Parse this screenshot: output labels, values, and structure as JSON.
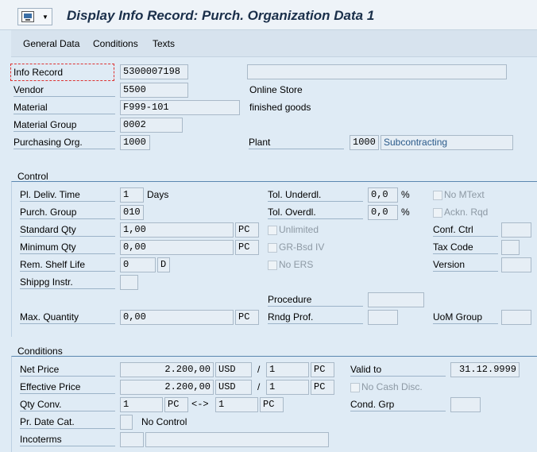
{
  "title": "Display Info Record: Purch. Organization Data 1",
  "toolbar": {
    "tabs": [
      "General Data",
      "Conditions",
      "Texts"
    ]
  },
  "header": {
    "info_record_label": "Info Record",
    "info_record": "5300007198",
    "vendor_label": "Vendor",
    "vendor": "5500",
    "vendor_name": "Online Store",
    "material_label": "Material",
    "material": "F999-101",
    "material_desc": "finished goods",
    "material_group_label": "Material Group",
    "material_group": "0002",
    "purch_org_label": "Purchasing Org.",
    "purch_org": "1000",
    "plant_label": "Plant",
    "plant": "1000",
    "plant_text": "Subcontracting"
  },
  "control": {
    "title": "Control",
    "pl_deliv_label": "Pl. Deliv. Time",
    "pl_deliv": "1",
    "days": "Days",
    "purch_group_label": "Purch. Group",
    "purch_group": "010",
    "std_qty_label": "Standard Qty",
    "std_qty": "1,00",
    "std_uom": "PC",
    "min_qty_label": "Minimum Qty",
    "min_qty": "0,00",
    "min_uom": "PC",
    "shelf_label": "Rem. Shelf Life",
    "shelf": "0",
    "shelf_unit": "D",
    "shippg_label": "Shippg Instr.",
    "max_qty_label": "Max. Quantity",
    "max_qty": "0,00",
    "max_uom": "PC",
    "tol_under_label": "Tol. Underdl.",
    "tol_under": "0,0",
    "pct": "%",
    "tol_over_label": "Tol. Overdl.",
    "tol_over": "0,0",
    "unlimited_label": "Unlimited",
    "grbsd_label": "GR-Bsd IV",
    "noers_label": "No ERS",
    "procedure_label": "Procedure",
    "rndg_label": "Rndg Prof.",
    "nomtext_label": "No MText",
    "acknrqd_label": "Ackn. Rqd",
    "confctrl_label": "Conf. Ctrl",
    "taxcode_label": "Tax Code",
    "version_label": "Version",
    "uomgroup_label": "UoM Group"
  },
  "conditions": {
    "title": "Conditions",
    "net_price_label": "Net Price",
    "net_price": "2.200,00",
    "net_cur": "USD",
    "slash": "/",
    "net_per": "1",
    "net_uom": "PC",
    "eff_price_label": "Effective Price",
    "eff_price": "2.200,00",
    "eff_cur": "USD",
    "eff_per": "1",
    "eff_uom": "PC",
    "qty_conv_label": "Qty Conv.",
    "qty_conv_a": "1",
    "qty_conv_a_uom": "PC",
    "arrow": "<->",
    "qty_conv_b": "1",
    "qty_conv_b_uom": "PC",
    "pr_date_label": "Pr. Date Cat.",
    "pr_date_text": "No Control",
    "incoterms_label": "Incoterms",
    "valid_to_label": "Valid to",
    "valid_to": "31.12.9999",
    "nocash_label": "No Cash Disc.",
    "condgrp_label": "Cond. Grp"
  }
}
